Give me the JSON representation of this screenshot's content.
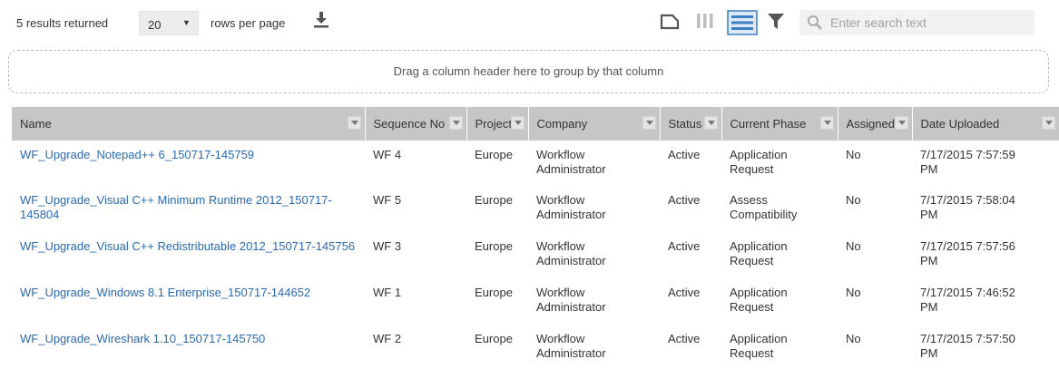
{
  "toolbar": {
    "results_text": "5 results returned",
    "rows_per_page_value": "20",
    "rows_per_page_label": "rows per page",
    "search_placeholder": "Enter search text",
    "icons": [
      "download-icon",
      "maximize-icon",
      "columns-icon",
      "grid-view-icon",
      "filter-icon",
      "search-icon"
    ]
  },
  "group_zone": {
    "text": "Drag a column header here to group by that column"
  },
  "table": {
    "columns": [
      "Name",
      "Sequence No",
      "Project",
      "Company",
      "Status",
      "Current Phase",
      "Assigned",
      "Date Uploaded"
    ],
    "rows": [
      {
        "name": "WF_Upgrade_Notepad++ 6_150717-145759",
        "sequence": "WF 4",
        "project": "Europe",
        "company_l1": "Workflow",
        "company_l2": "Administrator",
        "status": "Active",
        "phase_l1": "Application",
        "phase_l2": "Request",
        "assigned": "No",
        "date_l1": "7/17/2015 7:57:59",
        "date_l2": "PM"
      },
      {
        "name": "WF_Upgrade_Visual C++ Minimum Runtime 2012_150717-145804",
        "sequence": "WF 5",
        "project": "Europe",
        "company_l1": "Workflow",
        "company_l2": "Administrator",
        "status": "Active",
        "phase_l1": "Assess",
        "phase_l2": "Compatibility",
        "assigned": "No",
        "date_l1": "7/17/2015 7:58:04",
        "date_l2": "PM"
      },
      {
        "name": "WF_Upgrade_Visual C++ Redistributable 2012_150717-145756",
        "sequence": "WF 3",
        "project": "Europe",
        "company_l1": "Workflow",
        "company_l2": "Administrator",
        "status": "Active",
        "phase_l1": "Application",
        "phase_l2": "Request",
        "assigned": "No",
        "date_l1": "7/17/2015 7:57:56",
        "date_l2": "PM"
      },
      {
        "name": "WF_Upgrade_Windows 8.1 Enterprise_150717-144652",
        "sequence": "WF 1",
        "project": "Europe",
        "company_l1": "Workflow",
        "company_l2": "Administrator",
        "status": "Active",
        "phase_l1": "Application",
        "phase_l2": "Request",
        "assigned": "No",
        "date_l1": "7/17/2015 7:46:52",
        "date_l2": "PM"
      },
      {
        "name": "WF_Upgrade_Wireshark 1.10_150717-145750",
        "sequence": "WF 2",
        "project": "Europe",
        "company_l1": "Workflow",
        "company_l2": "Administrator",
        "status": "Active",
        "phase_l1": "Application",
        "phase_l2": "Request",
        "assigned": "No",
        "date_l1": "7/17/2015 7:57:50",
        "date_l2": "PM"
      }
    ]
  },
  "colors": {
    "link": "#2a6ab0",
    "header_bg": "#c6c6c6",
    "active_view_icon": "#3b7fc4",
    "toolbar_icon": "#555555"
  }
}
